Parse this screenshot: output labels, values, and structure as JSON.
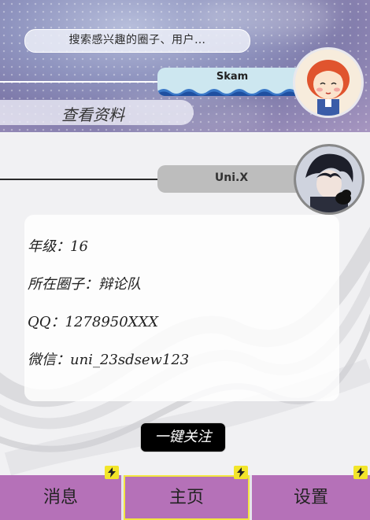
{
  "header": {
    "search_placeholder": "搜索感兴趣的圈子、用户…",
    "current_user_name": "Skam",
    "view_profile_label": "查看资料"
  },
  "profile": {
    "name": "Uni.X",
    "info": {
      "grade": "年级：16",
      "circle": "所在圈子：辩论队",
      "qq": "QQ：1278950XXX",
      "wechat": "微信：uni_23sdsew123"
    },
    "follow_label": "一键关注"
  },
  "tabs": [
    {
      "label": "消息",
      "active": false,
      "icon": "lightning-icon"
    },
    {
      "label": "主页",
      "active": true,
      "icon": "lightning-icon"
    },
    {
      "label": "设置",
      "active": false,
      "icon": "lightning-icon"
    }
  ],
  "colors": {
    "tab_bar": "#b571b8",
    "active_tab_border": "#f3e640",
    "bolt_badge": "#f2e52a",
    "follow_button": "#000000"
  }
}
